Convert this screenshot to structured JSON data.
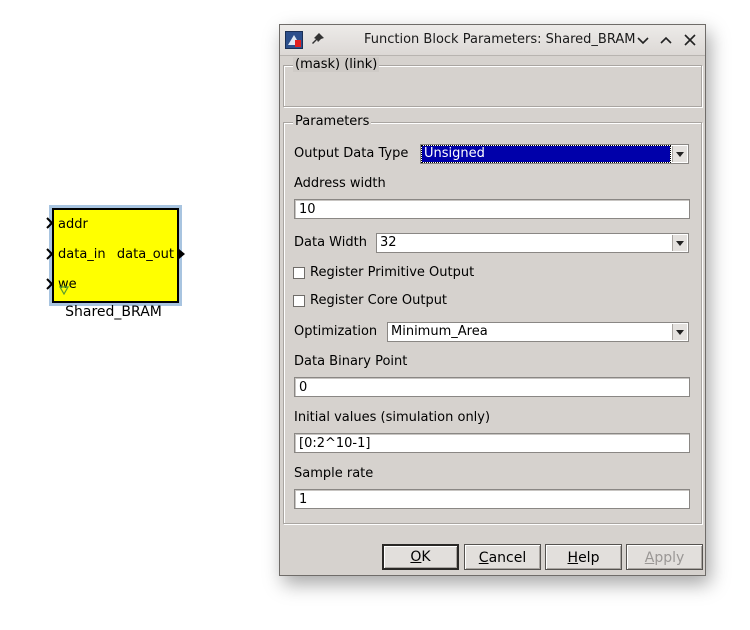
{
  "block": {
    "name": "Shared_BRAM",
    "ports_in": [
      "addr",
      "data_in",
      "we"
    ],
    "port_out": "data_out",
    "fill_color": "#ffff00"
  },
  "dialog": {
    "title": "Function Block Parameters: Shared_BRAM",
    "mask_label": "(mask) (link)",
    "params_group": "Parameters",
    "output_data_type": {
      "label": "Output Data Type",
      "value": "Unsigned"
    },
    "address_width": {
      "label": "Address width",
      "value": "10"
    },
    "data_width": {
      "label": "Data Width",
      "value": "32"
    },
    "register_primitive": {
      "label": "Register Primitive Output",
      "checked": false
    },
    "register_core": {
      "label": "Register Core Output",
      "checked": false
    },
    "optimization": {
      "label": "Optimization",
      "value": "Minimum_Area"
    },
    "data_binary_point": {
      "label": "Data Binary Point",
      "value": "0"
    },
    "initial_values": {
      "label": "Initial values (simulation only)",
      "value": "[0:2^10-1]"
    },
    "sample_rate": {
      "label": "Sample rate",
      "value": "1"
    },
    "buttons": {
      "ok": {
        "mnemonic": "O",
        "rest": "K"
      },
      "cancel": {
        "mnemonic": "C",
        "rest": "ancel"
      },
      "help": {
        "mnemonic": "H",
        "rest": "elp"
      },
      "apply": {
        "mnemonic": "A",
        "rest": "pply"
      }
    },
    "icons": [
      "app-icon",
      "pin-icon",
      "minimize-icon",
      "maximize-icon",
      "close-icon"
    ]
  }
}
